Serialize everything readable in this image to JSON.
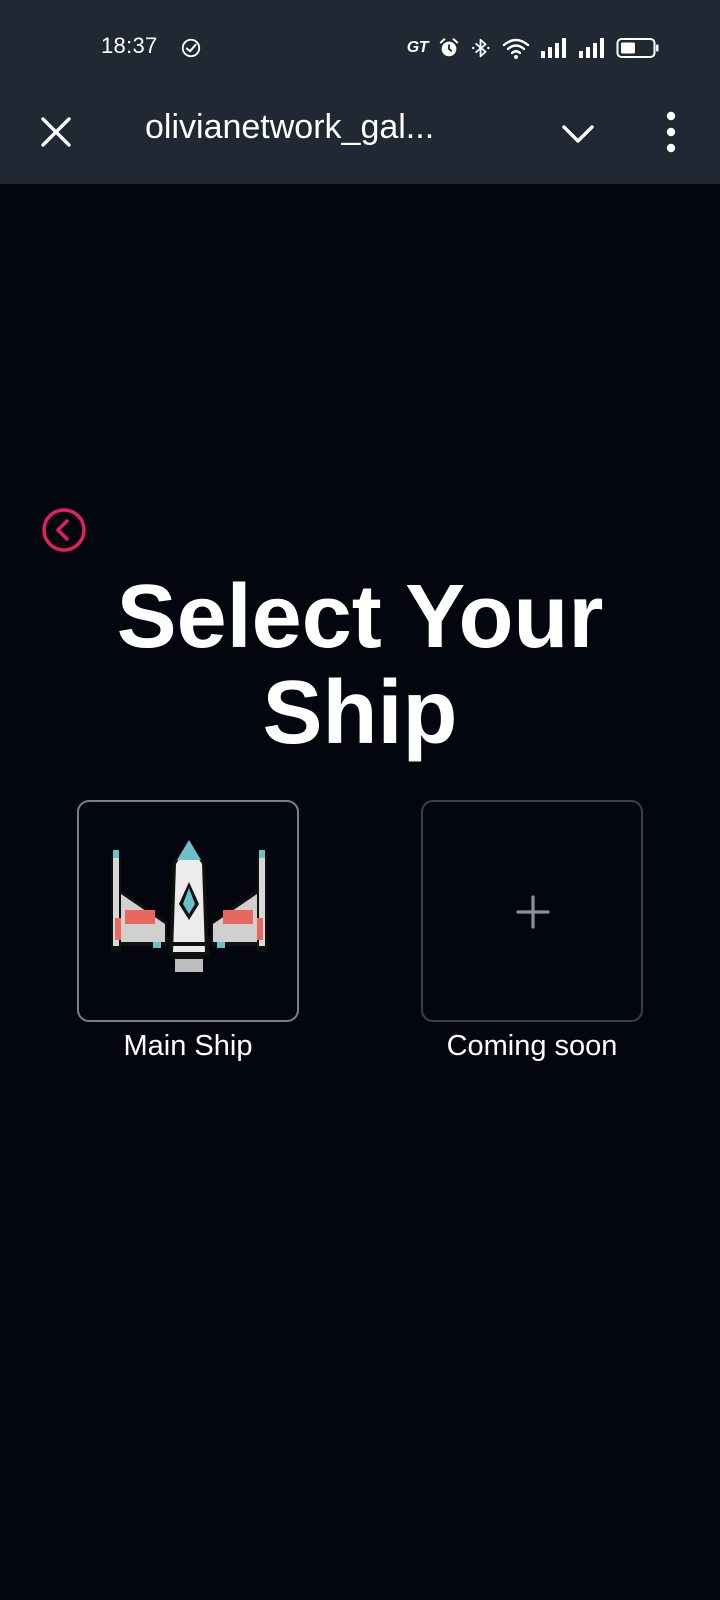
{
  "status_bar": {
    "time": "18:37",
    "network_label": "GT",
    "icons": [
      "check-circle-icon",
      "alarm-icon",
      "bluetooth-icon",
      "wifi-icon",
      "signal-icon",
      "signal-icon",
      "battery-icon"
    ]
  },
  "app_bar": {
    "title": "olivianetwork_gal...",
    "close_icon": "close-icon",
    "expand_icon": "chevron-down-icon",
    "menu_icon": "more-vert-icon"
  },
  "screen": {
    "back_icon": "back-arrow-icon",
    "title": "Select Your Ship",
    "accent_color": "#e0205f",
    "ships": [
      {
        "label": "Main Ship",
        "icon": "spaceship-icon",
        "state": "available"
      },
      {
        "label": "Coming soon",
        "icon": "plus-icon",
        "state": "locked"
      }
    ]
  }
}
